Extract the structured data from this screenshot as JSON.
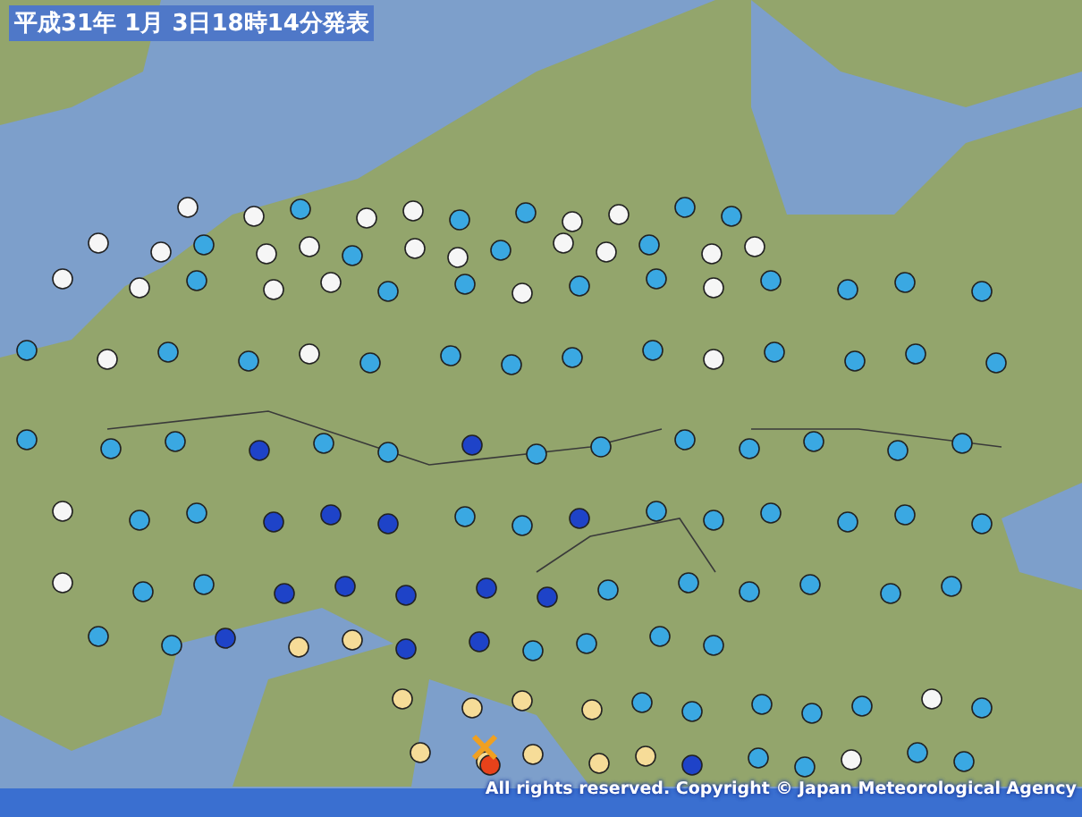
{
  "title": "平成31年 1月 3日18時14分発表",
  "copyright": "All rights reserved. Copyright © Japan Meteorological Agency"
}
